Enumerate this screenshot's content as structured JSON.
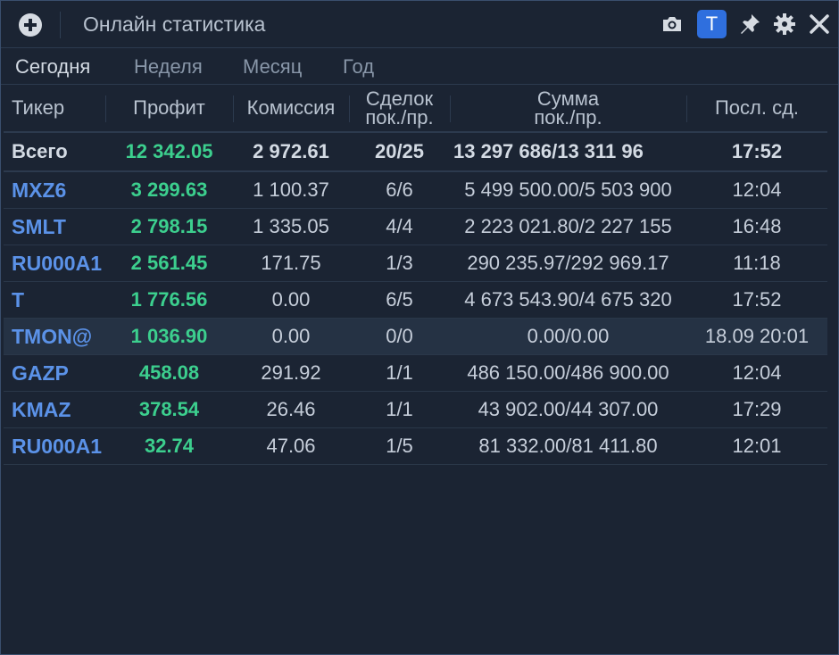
{
  "window": {
    "title": "Онлайн статистика",
    "t_button": "T"
  },
  "tabs": [
    "Сегодня",
    "Неделя",
    "Месяц",
    "Год"
  ],
  "active_tab": "Сегодня",
  "columns": {
    "ticker": "Тикер",
    "profit": "Профит",
    "commission": "Комиссия",
    "deals_1": "Сделок",
    "deals_2": "пок./пр.",
    "sum_1": "Сумма",
    "sum_2": "пок./пр.",
    "last": "Посл. сд."
  },
  "total": {
    "ticker": "Всего",
    "profit": "12 342.05",
    "commission": "2 972.61",
    "deals": "20/25",
    "sum": "13 297 686/13 311 96",
    "last": "17:52"
  },
  "rows": [
    {
      "ticker": "MXZ6",
      "profit": "3 299.63",
      "commission": "1 100.37",
      "deals": "6/6",
      "sum": "5 499 500.00/5 503 900",
      "last": "12:04"
    },
    {
      "ticker": "SMLT",
      "profit": "2 798.15",
      "commission": "1 335.05",
      "deals": "4/4",
      "sum": "2 223 021.80/2 227 155",
      "last": "16:48"
    },
    {
      "ticker": "RU000A1",
      "profit": "2 561.45",
      "commission": "171.75",
      "deals": "1/3",
      "sum": "290 235.97/292 969.17",
      "last": "11:18"
    },
    {
      "ticker": "T",
      "profit": "1 776.56",
      "commission": "0.00",
      "deals": "6/5",
      "sum": "4 673 543.90/4 675 320",
      "last": "17:52"
    },
    {
      "ticker": "TMON@",
      "profit": "1 036.90",
      "commission": "0.00",
      "deals": "0/0",
      "sum": "0.00/0.00",
      "last": "18.09 20:01"
    },
    {
      "ticker": "GAZP",
      "profit": "458.08",
      "commission": "291.92",
      "deals": "1/1",
      "sum": "486 150.00/486 900.00",
      "last": "12:04"
    },
    {
      "ticker": "KMAZ",
      "profit": "378.54",
      "commission": "26.46",
      "deals": "1/1",
      "sum": "43 902.00/44 307.00",
      "last": "17:29"
    },
    {
      "ticker": "RU000A1",
      "profit": "32.74",
      "commission": "47.06",
      "deals": "1/5",
      "sum": "81 332.00/81 411.80",
      "last": "12:01"
    }
  ],
  "icons": {
    "add": "plus-circle-icon",
    "camera": "camera-icon",
    "pin": "pin-icon",
    "settings": "gear-icon",
    "close": "close-icon"
  },
  "colors": {
    "background": "#1b2433",
    "profit": "#3ccf8e",
    "ticker": "#5b92e8",
    "accent": "#2f6fde"
  }
}
